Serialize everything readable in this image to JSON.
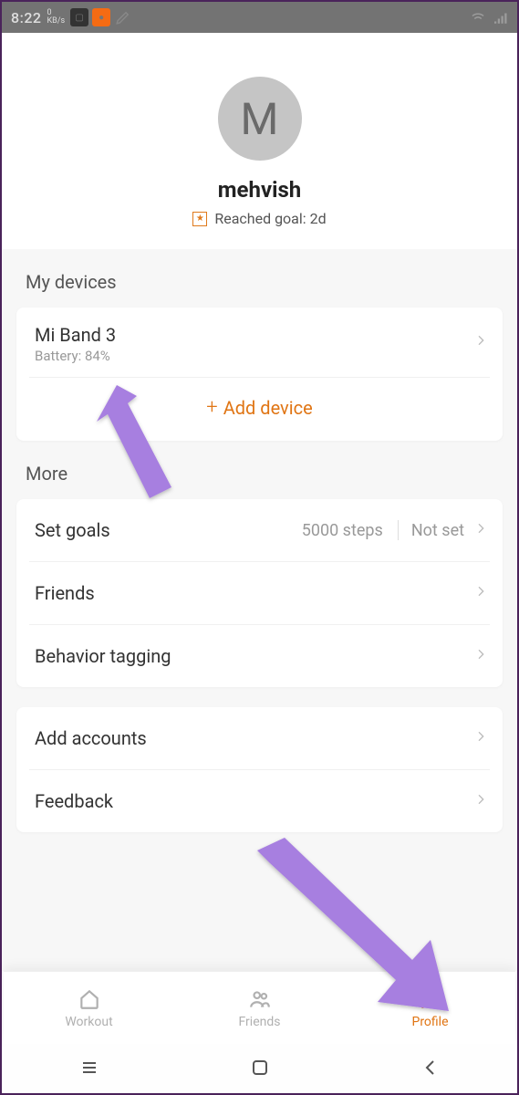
{
  "status": {
    "time": "8:22",
    "net_top": "0",
    "net_bottom": "KB/s"
  },
  "profile": {
    "avatar_initial": "M",
    "username": "mehvish",
    "goal_text": "Reached goal: 2d"
  },
  "sections": {
    "devices_title": "My devices",
    "more_title": "More"
  },
  "device": {
    "name": "Mi Band 3",
    "battery": "Battery: 84%",
    "add_label": "Add device"
  },
  "more": {
    "set_goals": {
      "label": "Set goals",
      "steps": "5000 steps",
      "weight": "Not set"
    },
    "friends": {
      "label": "Friends"
    },
    "behavior": {
      "label": "Behavior tagging"
    },
    "add_accounts": {
      "label": "Add accounts"
    },
    "feedback": {
      "label": "Feedback"
    }
  },
  "nav": {
    "workout": "Workout",
    "friends": "Friends",
    "profile": "Profile"
  }
}
